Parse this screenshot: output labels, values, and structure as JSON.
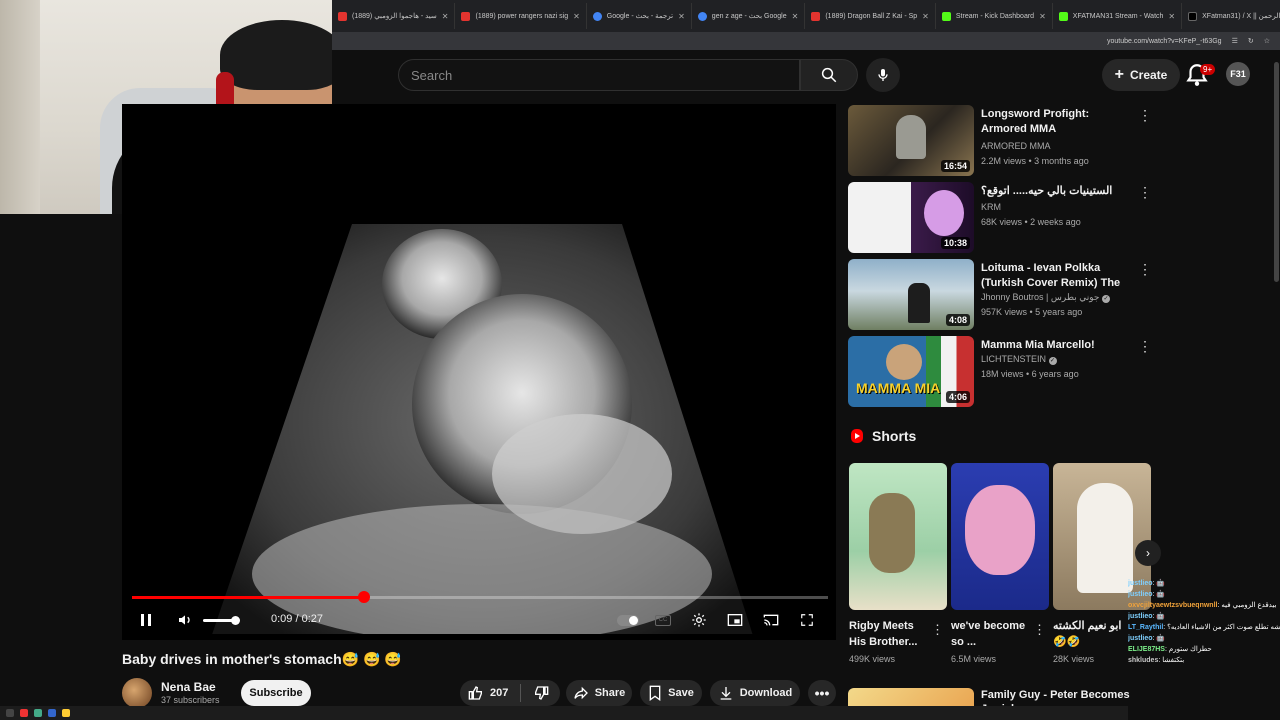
{
  "browser": {
    "tabs": [
      {
        "label": "(1889) سيد - هاجموا الزومبي",
        "icon": "youtube-icon"
      },
      {
        "label": "(1889) power rangers nazi sig",
        "icon": "youtube-icon"
      },
      {
        "label": "Google - ترجمة - بحث",
        "icon": "google-icon"
      },
      {
        "label": "gen z age - بحث Google",
        "icon": "google-icon"
      },
      {
        "label": "(1889) Dragon Ball Z Kai - Sp",
        "icon": "youtube-icon"
      },
      {
        "label": "Stream - Kick Dashboard",
        "icon": "kick-icon"
      },
      {
        "label": "XFATMAN31 Stream - Watch",
        "icon": "kick-icon"
      },
      {
        "label": "XFatman31) / X || عبد الرحمن",
        "icon": "x-icon"
      }
    ],
    "url": "youtube.com/watch?v=KFeP_-t63Gg"
  },
  "header": {
    "search_placeholder": "Search",
    "create_label": "Create",
    "notifications_badge": "9+",
    "avatar_initials": "F31"
  },
  "player": {
    "time": "0:09 / 0:27",
    "progress_fraction": 0.333
  },
  "video": {
    "title": "Baby drives in mother's stomach😅 😅 😅",
    "channel_name": "Nena Bae",
    "subscribers": "37 subscribers",
    "subscribe_label": "Subscribe",
    "likes": "207",
    "share_label": "Share",
    "save_label": "Save",
    "download_label": "Download"
  },
  "recommendations": [
    {
      "title": "Longsword Profight: Armored MMA",
      "channel": "ARMORED MMA",
      "meta": "2.2M views • 3 months ago",
      "duration": "16:54",
      "verified": false
    },
    {
      "title": "الستينيات بالي حيه..... اتوقع؟",
      "channel": "KRM",
      "meta": "68K views • 2 weeks ago",
      "duration": "10:38",
      "verified": false
    },
    {
      "title": "Loituma - Ievan Polkka (Turkish Cover Remix) The Original For ...",
      "channel": "Jhonny Boutros | جوني بطرس",
      "meta": "957K views • 5 years ago",
      "duration": "4:08",
      "verified": true
    },
    {
      "title": "Mamma Mia Marcello!",
      "channel": "LICHTENSTEIN",
      "meta": "18M views • 6 years ago",
      "duration": "4:06",
      "verified": true
    }
  ],
  "shorts": {
    "heading": "Shorts",
    "items": [
      {
        "title": "Rigby Meets His Brother...",
        "views": "499K views"
      },
      {
        "title": "we've become so ...",
        "views": "6.5M views"
      },
      {
        "title": "ابو نعيم الكشته 🤣🤣",
        "views": "28K views"
      }
    ]
  },
  "last_recommendation": {
    "title": "Family Guy - Peter Becomes Jewish"
  },
  "chat": [
    {
      "user": "justlieo",
      "text": ": 🤖"
    },
    {
      "user": "justlieo",
      "text": ": 🤖"
    },
    {
      "user": "oxvcjiltyaewtzsvbueqnwnll",
      "text": ": بيدقدع الزومبي فيه"
    },
    {
      "user": "justlieo",
      "text": ": 🤖"
    },
    {
      "user": "LT_Raythil",
      "text": ": تدرون ان الاشياء المقرمشه تطلع صوت اكثر من الاشياء العاديه؟"
    },
    {
      "user": "justlieo",
      "text": ": 🤖"
    },
    {
      "user": "ELIJE87HS",
      "text": ": حطزاك ستورم"
    },
    {
      "user": "shkludes",
      "text": ": بتكتفشا"
    }
  ],
  "colors": {
    "accent": "#ff0000",
    "background": "#0f0f0f",
    "chip": "#272727"
  }
}
